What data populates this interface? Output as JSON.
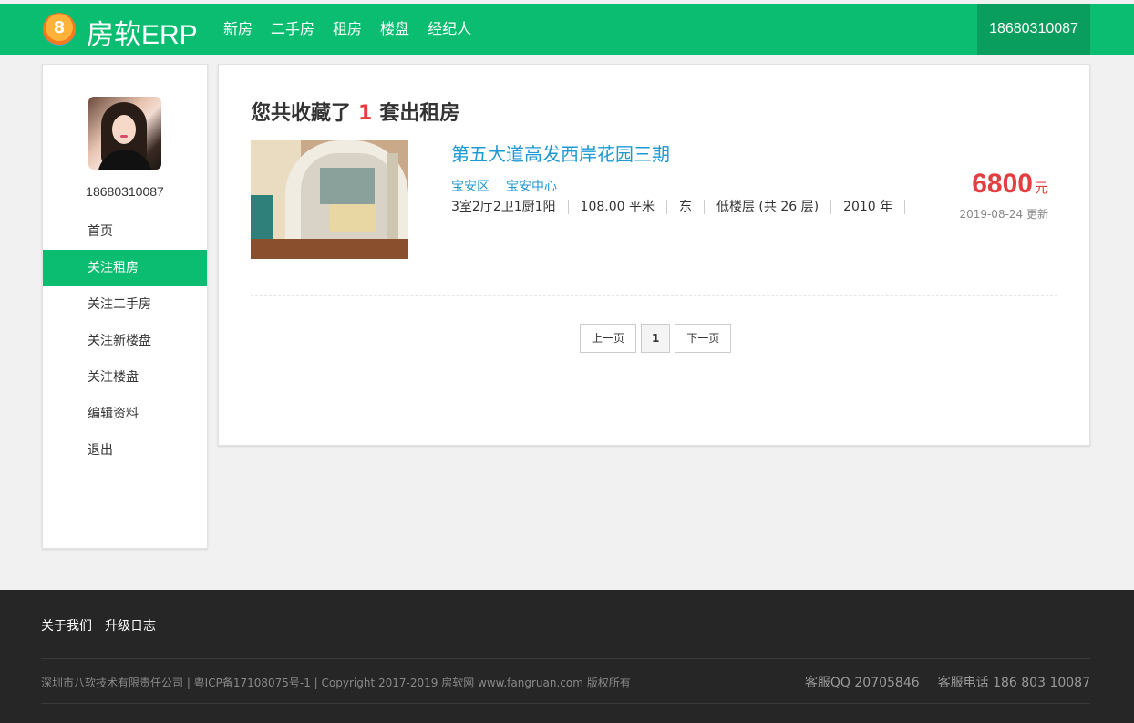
{
  "header": {
    "logo_badge": "8",
    "logo_text": "房软ERP",
    "nav": [
      "新房",
      "二手房",
      "租房",
      "楼盘",
      "经纪人"
    ],
    "phone": "18680310087"
  },
  "sidebar": {
    "username": "18680310087",
    "menu": [
      "首页",
      "关注租房",
      "关注二手房",
      "关注新楼盘",
      "关注楼盘",
      "编辑资料",
      "退出"
    ],
    "active_index": 1
  },
  "main": {
    "summary_prefix": "您共收藏了",
    "summary_count": "1",
    "summary_suffix": "套出租房",
    "listing": {
      "title": "第五大道高发西岸花园三期",
      "district": "宝安区",
      "area": "宝安中心",
      "layout": "3室2厅2卫1厨1阳",
      "size": "108.00 平米",
      "orientation": "东",
      "floor": "低楼层 (共 26 层)",
      "year": "2010 年",
      "price": "6800",
      "price_unit": "元",
      "updated": "2019-08-24 更新"
    },
    "pager": {
      "prev": "上一页",
      "current": "1",
      "next": "下一页"
    }
  },
  "footer": {
    "links": [
      "关于我们",
      "升级日志"
    ],
    "copyright": "深圳市八软技术有限责任公司 | 粤ICP备17108075号-1 | Copyright 2017-2019 房软网 www.fangruan.com 版权所有",
    "qq": "客服QQ 20705846",
    "tel": "客服电话 186 803 10087"
  },
  "colors": {
    "brand_green": "#0bbd70",
    "price_red": "#e24040",
    "link_blue": "#1e9ad3"
  }
}
